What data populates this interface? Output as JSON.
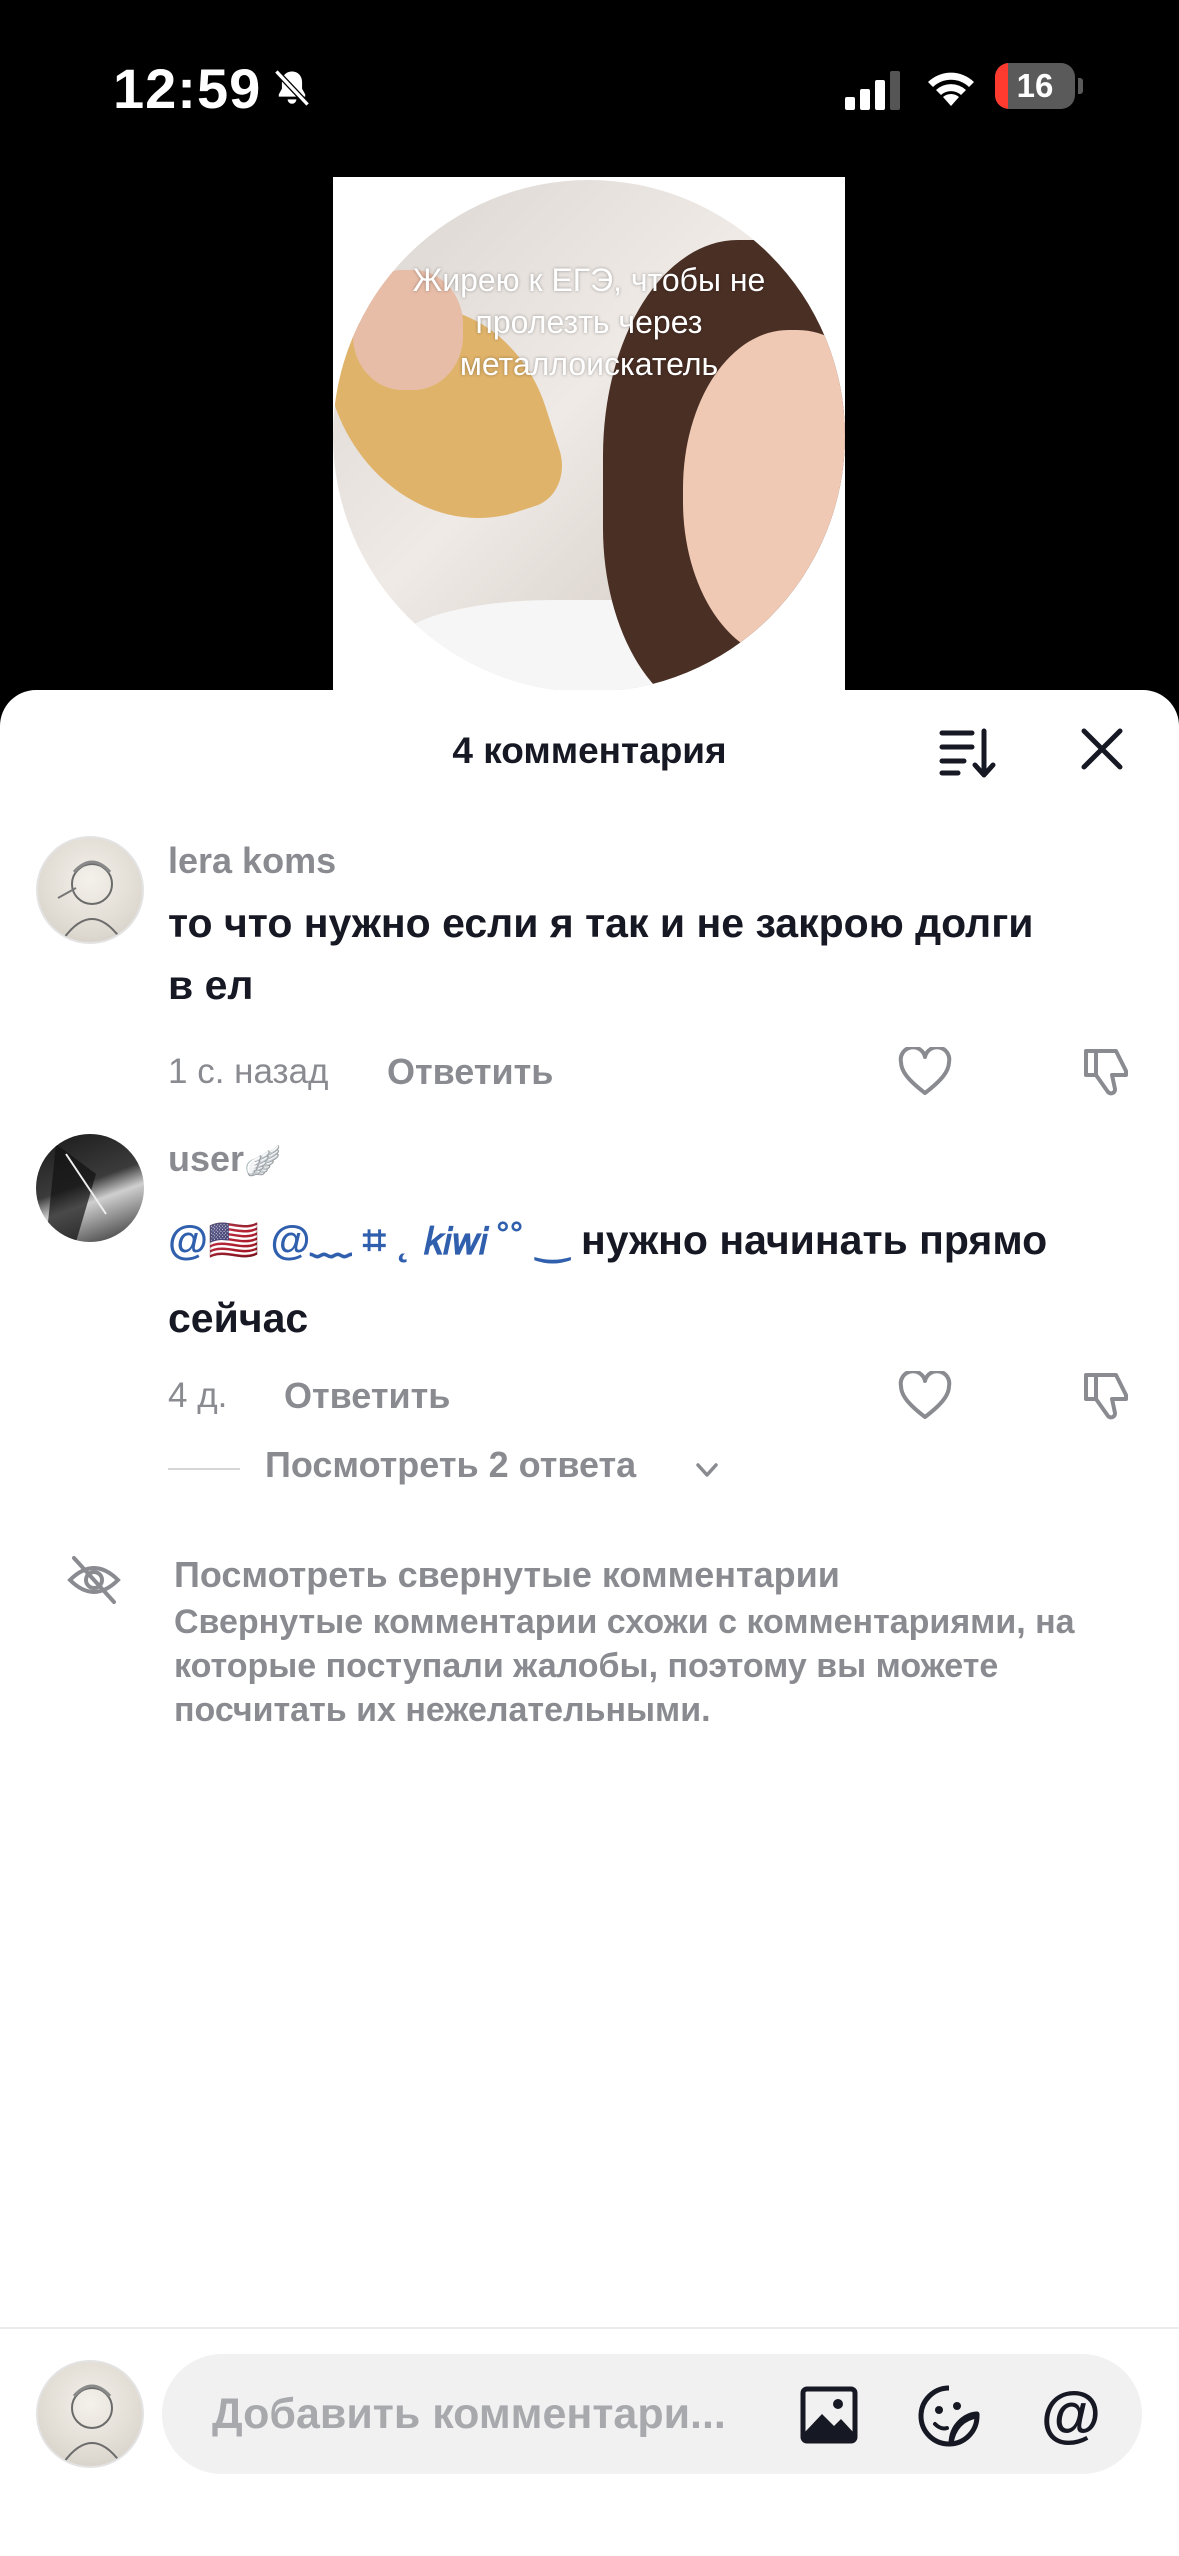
{
  "status_bar": {
    "time": "12:59",
    "battery": "16",
    "battery_level": 0.16
  },
  "video": {
    "caption": "Жирею к ЕГЭ, чтобы не пролезть через металлоискатель"
  },
  "sheet": {
    "title": "4 комментария",
    "comments": [
      {
        "username": "lera koms",
        "text": "то что нужно если я так и не закрою долги в ел",
        "time": "1 с. назад",
        "reply_label": "Ответить"
      },
      {
        "username": "user",
        "username_suffix": "🪽",
        "mention_1": "@🇺🇸",
        "mention_2": "@﹏ ⌗ ˛ 𝘬𝘪𝘸𝘪 ˚˚ ‿",
        "text": "нужно начинать прямо сейчас",
        "time": "4 д.",
        "reply_label": "Ответить"
      }
    ],
    "view_replies": "Посмотреть 2 ответа",
    "collapsed": {
      "title": "Посмотреть свернутые комментарии",
      "description": "Свернутые комментарии схожи с комментариями, на которые поступали жалобы, поэтому вы можете посчитать их нежелательными."
    }
  },
  "composer": {
    "placeholder": "Добавить комментари..."
  }
}
